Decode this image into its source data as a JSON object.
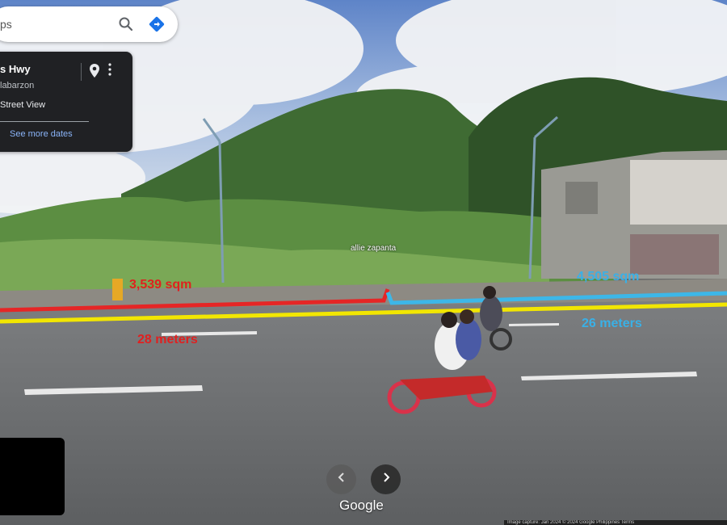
{
  "search": {
    "query": "ps"
  },
  "location_card": {
    "title": "s Hwy",
    "subtitle": "labarzon",
    "view_label": "Street View",
    "see_more_dates": "See more dates"
  },
  "overlays": {
    "area_left": "3,539 sqm",
    "width_left": "28 meters",
    "area_right": "4,505 sqm",
    "width_right": "26 meters",
    "sign_text": "allie zapanta"
  },
  "footer": {
    "brand": "Google",
    "info": "Image capture: Jan 2024   © 2024 Google   Philippines   Terms"
  },
  "colors": {
    "red_line": "#e52626",
    "yellow_line": "#f2e600",
    "blue_line": "#3db7e8"
  }
}
